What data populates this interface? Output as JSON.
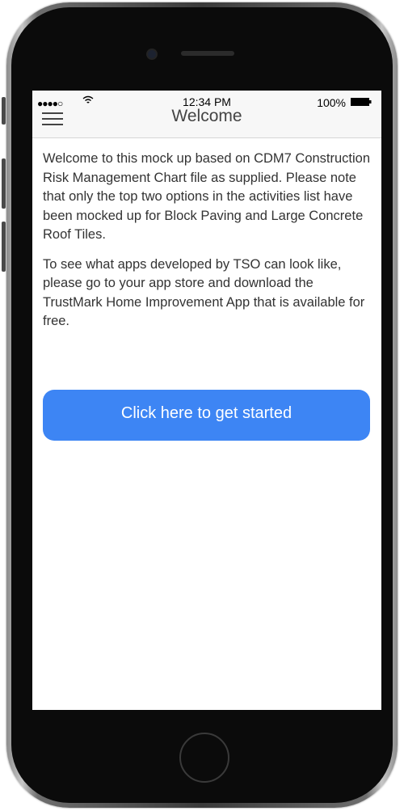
{
  "status_bar": {
    "signal": "●●●●○",
    "time": "12:34 PM",
    "battery": "100%"
  },
  "navbar": {
    "title": "Welcome"
  },
  "content": {
    "paragraph_1": "Welcome to this mock up based on CDM7 Construction Risk Management Chart file as supplied. Please note that only the top two options in the activities list have been mocked up for Block Paving and Large Concrete Roof Tiles.",
    "paragraph_2": "To see what apps developed by TSO can look like, please go to your app store and download the TrustMark Home Improvement App that is available for free."
  },
  "actions": {
    "start_label": "Click here to get started"
  },
  "icons": {
    "menu": "hamburger-menu-icon",
    "wifi": "wifi-icon",
    "battery": "battery-icon"
  },
  "colors": {
    "button": "#3d85f4",
    "navbar_bg": "#f7f7f7",
    "text": "#333333"
  }
}
